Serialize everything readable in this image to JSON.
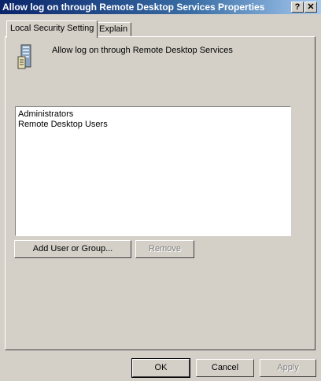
{
  "window": {
    "title": "Allow log on through Remote Desktop Services Properties",
    "help_button": "?",
    "close_button": "✕"
  },
  "tabs": [
    {
      "label": "Local Security Setting",
      "active": true
    },
    {
      "label": "Explain",
      "active": false
    }
  ],
  "policy": {
    "icon": "server-policy-icon",
    "name": "Allow log on through Remote Desktop Services"
  },
  "members": [
    "Administrators",
    "Remote Desktop Users"
  ],
  "buttons": {
    "add": "Add User or Group...",
    "remove": "Remove",
    "ok": "OK",
    "cancel": "Cancel",
    "apply": "Apply"
  }
}
